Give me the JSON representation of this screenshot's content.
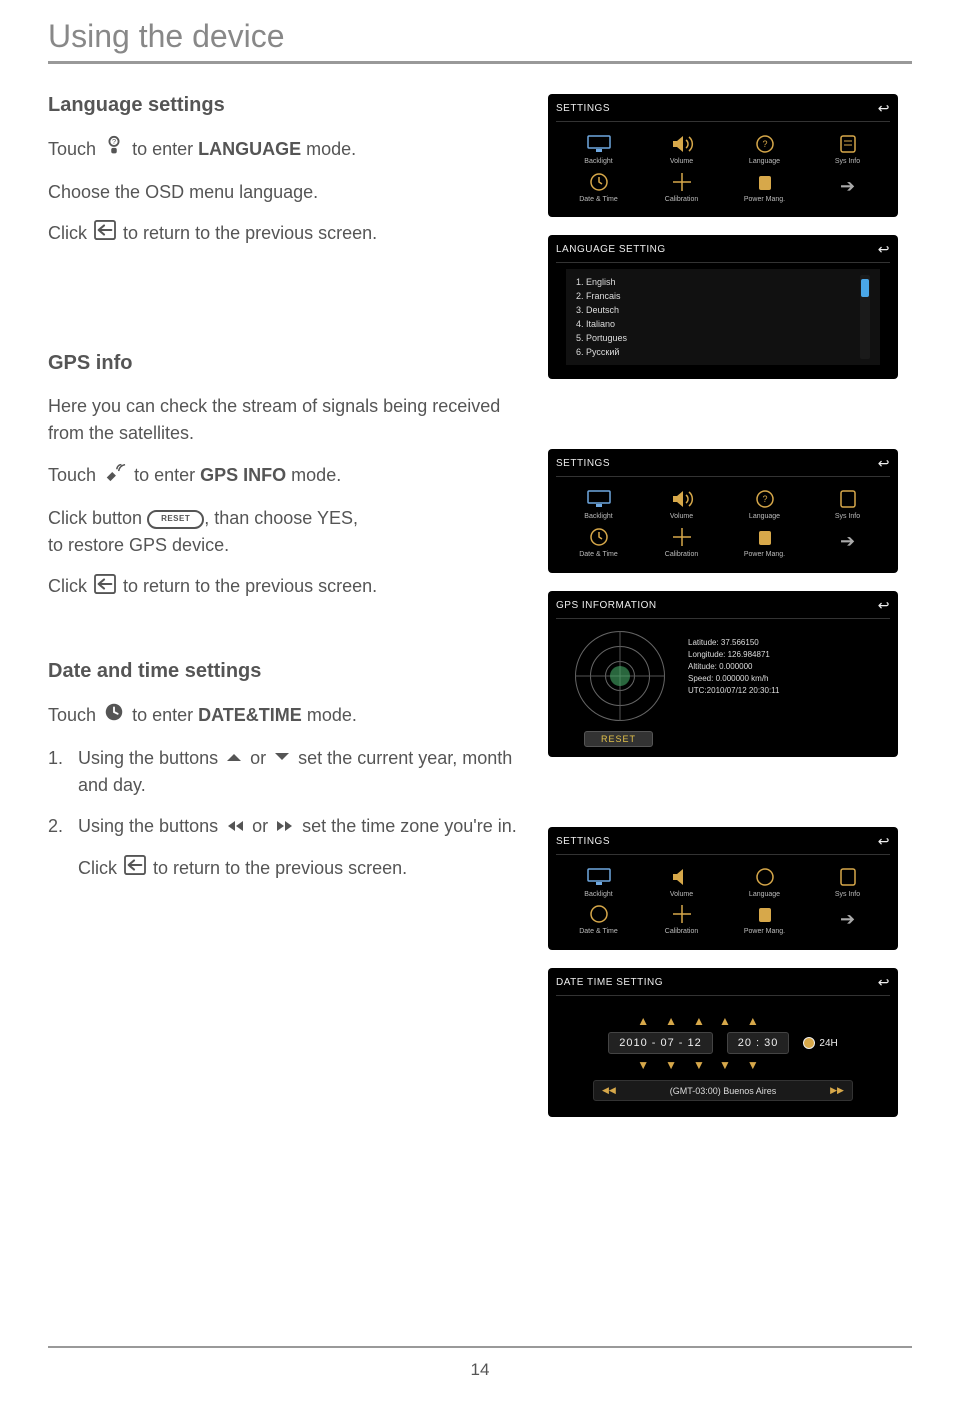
{
  "page": {
    "title": "Using the device",
    "number": "14"
  },
  "sections": {
    "language": {
      "heading": "Language settings",
      "line1a": "Touch",
      "line1b": "to enter",
      "line1c": "LANGUAGE",
      "line1d": "mode.",
      "line2": "Choose the OSD menu language.",
      "line3a": "Click",
      "line3b": "to return to the previous screen."
    },
    "gps": {
      "heading": "GPS info",
      "line1": "Here you can check the stream of signals being received from the satellites.",
      "line2a": "Touch",
      "line2b": "to enter",
      "line2c": "GPS INFO",
      "line2d": "mode.",
      "line3a": "Click button",
      "line3b": ", than choose YES,",
      "line3c": "to restore GPS device.",
      "reset_label": "RESET",
      "line4a": "Click",
      "line4b": "to return to the previous screen."
    },
    "datetime": {
      "heading": "Date and time settings",
      "line1a": "Touch",
      "line1b": "to enter",
      "line1c": "DATE&TIME",
      "line1d": "mode.",
      "item1_num": "1.",
      "item1a": "Using the buttons",
      "item1b": "or",
      "item1c": "set the current year, month and day.",
      "item2_num": "2.",
      "item2a": "Using the buttons",
      "item2b": "or",
      "item2c": "set the time zone you're in.",
      "line_last_a": "Click",
      "line_last_b": "to return to the previous screen."
    }
  },
  "screens": {
    "settings": {
      "title": "SETTINGS",
      "items": [
        "Backlight",
        "Volume",
        "Language",
        "Sys Info",
        "Date & Time",
        "Calibration",
        "Power Mang."
      ]
    },
    "language": {
      "title": "LANGUAGE SETTING",
      "options": [
        "1. English",
        "2. Francais",
        "3. Deutsch",
        "4. Italiano",
        "5. Portugues",
        "6. Русский"
      ]
    },
    "gpsinfo": {
      "title": "GPS INFORMATION",
      "lat": "Latitude: 37.566150",
      "lon": "Longitude: 126.984871",
      "alt": "Altitude: 0.000000",
      "speed": "Speed: 0.000000 km/h",
      "utc": "UTC:2010/07/12 20:30:11",
      "reset": "RESET"
    },
    "datetime": {
      "title": "DATE TIME SETTING",
      "date": "2010 - 07 - 12",
      "time": "20 : 30",
      "h24": "24H",
      "tz": "(GMT-03:00) Buenos Aires"
    }
  }
}
